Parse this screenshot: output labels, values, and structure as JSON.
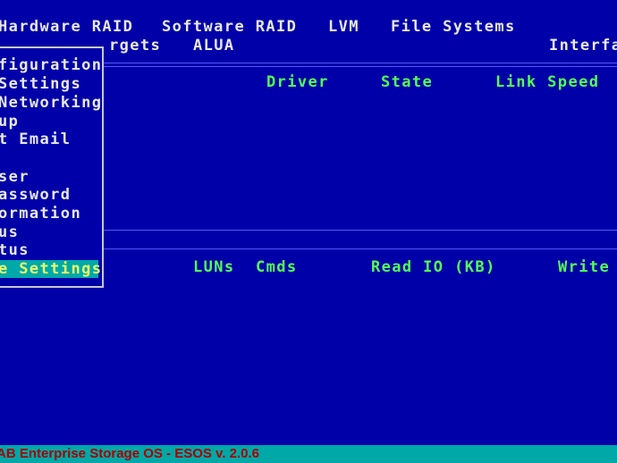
{
  "menubar": {
    "items": [
      "Hardware RAID",
      "Software RAID",
      "LVM",
      "File Systems"
    ]
  },
  "submenu": {
    "targets": "rgets",
    "alua": "ALUA",
    "interfaces": "Interfa"
  },
  "interfaces_table": {
    "columns": [
      "Driver",
      "State",
      "Link Speed"
    ]
  },
  "stats_table": {
    "columns": [
      "LUNs",
      "Cmds",
      "Read IO (KB)",
      "Write"
    ]
  },
  "dropdown": {
    "items": [
      "figuration",
      "Settings",
      "Networking",
      "up",
      "t Email",
      "ser",
      "assword",
      "ormation",
      "us",
      "tus",
      "e Settings"
    ],
    "selected_index": 10
  },
  "statusbar": {
    "text": "AB Enterprise Storage OS - ESOS v. 2.0.6"
  },
  "colors": {
    "background": "#0000a8",
    "status_bar": "#00a8a8",
    "status_text": "#aa0000",
    "highlight_bg": "#00a8a8",
    "highlight_text": "#e8ff6a",
    "header_text": "#55ff55",
    "menu_text": "#e8e8e8"
  }
}
